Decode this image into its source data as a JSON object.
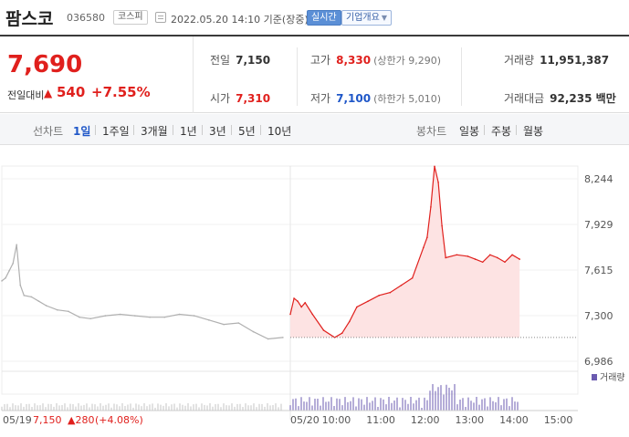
{
  "header": {
    "stock_name": "팜스코",
    "stock_code": "036580",
    "market_badge": "코스피",
    "timestamp": "2022.05.20 14:10 기준(장중)",
    "realtime_label": "실시간",
    "company_info_label": "기업개요"
  },
  "price": {
    "current": "7,690",
    "change_label": "전일대비",
    "change_value": "540",
    "change_percent": "+7.55%",
    "direction_icon": "up-triangle-icon",
    "color_up": "#e0201d",
    "color_down": "#1f57c8"
  },
  "stats": {
    "prev_close_label": "전일",
    "prev_close": "7,150",
    "high_label": "고가",
    "high": "8,330",
    "upper_limit": "(상한가 9,290)",
    "volume_label": "거래량",
    "volume": "11,951,387",
    "open_label": "시가",
    "open": "7,310",
    "low_label": "저가",
    "low": "7,100",
    "lower_limit": "(하한가 5,010)",
    "amount_label": "거래대금",
    "amount": "92,235 백만"
  },
  "period_bar": {
    "line_chart_label": "선차트",
    "line_options": [
      "1일",
      "1주일",
      "3개월",
      "1년",
      "3년",
      "5년",
      "10년"
    ],
    "line_active": "1일",
    "candle_chart_label": "봉차트",
    "candle_options": [
      "일봉",
      "주봉",
      "월봉"
    ]
  },
  "chart_data": {
    "type": "line",
    "y_ticks": [
      "8,244",
      "7,929",
      "7,615",
      "7,300",
      "6,986"
    ],
    "ylim": [
      6986,
      8244
    ],
    "prev_close_line": 7150,
    "x_ticks": [
      "05/19",
      "05/20",
      "10:00",
      "11:00",
      "12:00",
      "13:00",
      "14:00",
      "15:00"
    ],
    "prev_day_caption": "05/19",
    "prev_day_close": "7,150",
    "prev_day_change": "▲280",
    "prev_day_pct": "(+4.08%)",
    "volume_legend": "거래량",
    "series": [
      {
        "name": "05/19",
        "x": [
          "09:00",
          "09:05",
          "09:10",
          "09:15",
          "09:20",
          "09:25",
          "09:30",
          "09:40",
          "09:50",
          "10:00",
          "10:15",
          "10:30",
          "10:45",
          "11:00",
          "11:20",
          "11:40",
          "12:00",
          "12:20",
          "12:40",
          "13:00",
          "13:20",
          "13:40",
          "14:00",
          "14:20",
          "14:40",
          "15:00",
          "15:20"
        ],
        "values": [
          7540,
          7560,
          7610,
          7660,
          7790,
          7510,
          7440,
          7430,
          7400,
          7370,
          7340,
          7330,
          7290,
          7280,
          7300,
          7310,
          7300,
          7290,
          7290,
          7310,
          7300,
          7270,
          7240,
          7250,
          7190,
          7140,
          7150
        ],
        "color": "#b0b0b0"
      },
      {
        "name": "05/20",
        "x": [
          "09:00",
          "09:05",
          "09:10",
          "09:15",
          "09:20",
          "09:30",
          "09:45",
          "10:00",
          "10:10",
          "10:20",
          "10:30",
          "10:45",
          "11:00",
          "11:15",
          "11:30",
          "11:45",
          "12:00",
          "12:05",
          "12:10",
          "12:15",
          "12:20",
          "12:25",
          "12:30",
          "12:45",
          "13:00",
          "13:10",
          "13:20",
          "13:30",
          "13:40",
          "13:50",
          "14:00",
          "14:10"
        ],
        "values": [
          7310,
          7420,
          7400,
          7360,
          7390,
          7310,
          7200,
          7150,
          7180,
          7260,
          7360,
          7400,
          7440,
          7460,
          7510,
          7560,
          7770,
          7840,
          8050,
          8330,
          8220,
          7920,
          7700,
          7720,
          7710,
          7690,
          7670,
          7720,
          7700,
          7670,
          7720,
          7690
        ],
        "color": "#e0201d"
      }
    ]
  }
}
